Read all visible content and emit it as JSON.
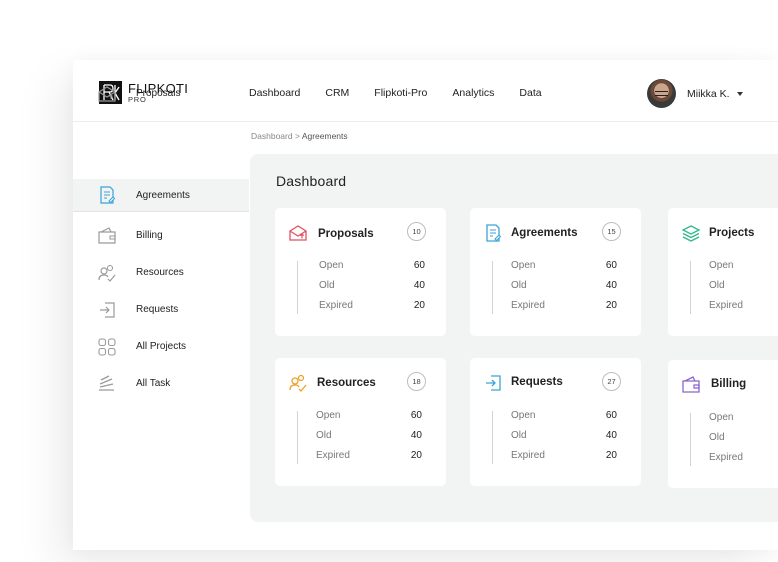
{
  "brand": {
    "name": "FLIPKOTI",
    "sub": "PRO"
  },
  "nav": [
    {
      "label": "Dashboard"
    },
    {
      "label": "CRM"
    },
    {
      "label": "Flipkoti-Pro"
    },
    {
      "label": "Analytics"
    },
    {
      "label": "Data"
    }
  ],
  "user": {
    "name": "Miikka K."
  },
  "sidebar": {
    "items": [
      {
        "label": "Proposals",
        "icon": "envelope-icon",
        "active": false
      },
      {
        "label": "Agreements",
        "icon": "document-icon",
        "active": true
      },
      {
        "label": "Billing",
        "icon": "wallet-icon",
        "active": false
      },
      {
        "label": "Resources",
        "icon": "users-icon",
        "active": false
      },
      {
        "label": "Requests",
        "icon": "sign-in-icon",
        "active": false
      },
      {
        "label": "All Projects",
        "icon": "grid-icon",
        "active": false
      },
      {
        "label": "All Task",
        "icon": "stack-icon",
        "active": false
      }
    ]
  },
  "breadcrumb": {
    "root": "Dashboard",
    "separator": " > ",
    "current": "Agreements"
  },
  "dashboard": {
    "title": "Dashboard",
    "stat_labels": {
      "open": "Open",
      "old": "Old",
      "expired": "Expired"
    },
    "cards": [
      {
        "title": "Proposals",
        "count": "10",
        "icon": "envelope-icon",
        "color": "#e05262",
        "open": "60",
        "old": "40",
        "expired": "20"
      },
      {
        "title": "Agreements",
        "count": "15",
        "icon": "document-icon",
        "color": "#3aa3d8",
        "open": "60",
        "old": "40",
        "expired": "20"
      },
      {
        "title": "Projects",
        "count": "",
        "icon": "layers-icon",
        "color": "#2fb88a",
        "open": "",
        "old": "",
        "expired": ""
      },
      {
        "title": "Resources",
        "count": "18",
        "icon": "users-icon",
        "color": "#f0a02a",
        "open": "60",
        "old": "40",
        "expired": "20"
      },
      {
        "title": "Requests",
        "count": "27",
        "icon": "sign-in-icon",
        "color": "#3aa3d8",
        "open": "60",
        "old": "40",
        "expired": "20"
      },
      {
        "title": "Billing",
        "count": "",
        "icon": "wallet-icon",
        "color": "#8a63d2",
        "open": "",
        "old": "",
        "expired": ""
      }
    ]
  }
}
